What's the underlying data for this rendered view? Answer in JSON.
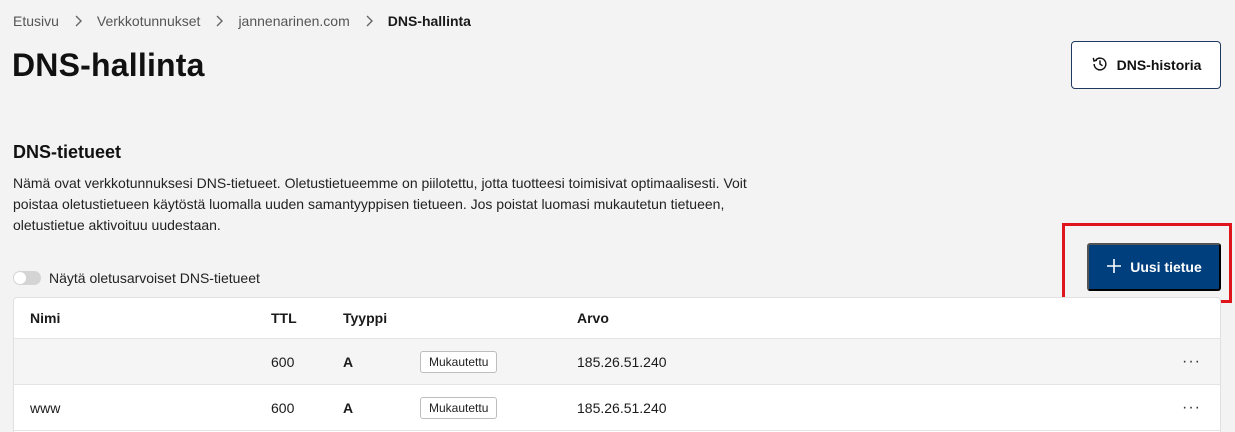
{
  "breadcrumb": {
    "items": [
      "Etusivu",
      "Verkkotunnukset",
      "jannenarinen.com",
      "DNS-hallinta"
    ]
  },
  "page_title": "DNS-hallinta",
  "history_button": {
    "label": "DNS-historia",
    "icon": "history-icon"
  },
  "section": {
    "title": "DNS-tietueet",
    "description": "Nämä ovat verkkotunnuksesi DNS-tietueet. Oletustietueemme on piilotettu, jotta tuotteesi toimisivat optimaalisesti. Voit poistaa oletustietueen käytöstä luomalla uuden samantyyppisen tietueen. Jos poistat luomasi mukautetun tietueen, oletustietue aktivoituu uudestaan."
  },
  "new_record_button": {
    "label": "Uusi tietue",
    "icon": "plus-icon"
  },
  "toggle": {
    "label": "Näytä oletusarvoiset DNS-tietueet",
    "checked": false
  },
  "table": {
    "columns": [
      "Nimi",
      "TTL",
      "Tyyppi",
      "Arvo"
    ],
    "rows": [
      {
        "name": "",
        "ttl": "600",
        "type": "A",
        "badge": "Mukautettu",
        "value": "185.26.51.240",
        "menu": "···"
      },
      {
        "name": "www",
        "ttl": "600",
        "type": "A",
        "badge": "Mukautettu",
        "value": "185.26.51.240",
        "menu": "···"
      }
    ]
  },
  "colors": {
    "primary": "#003f7d",
    "highlight": "#e0141b",
    "background": "#f3f3f3"
  }
}
